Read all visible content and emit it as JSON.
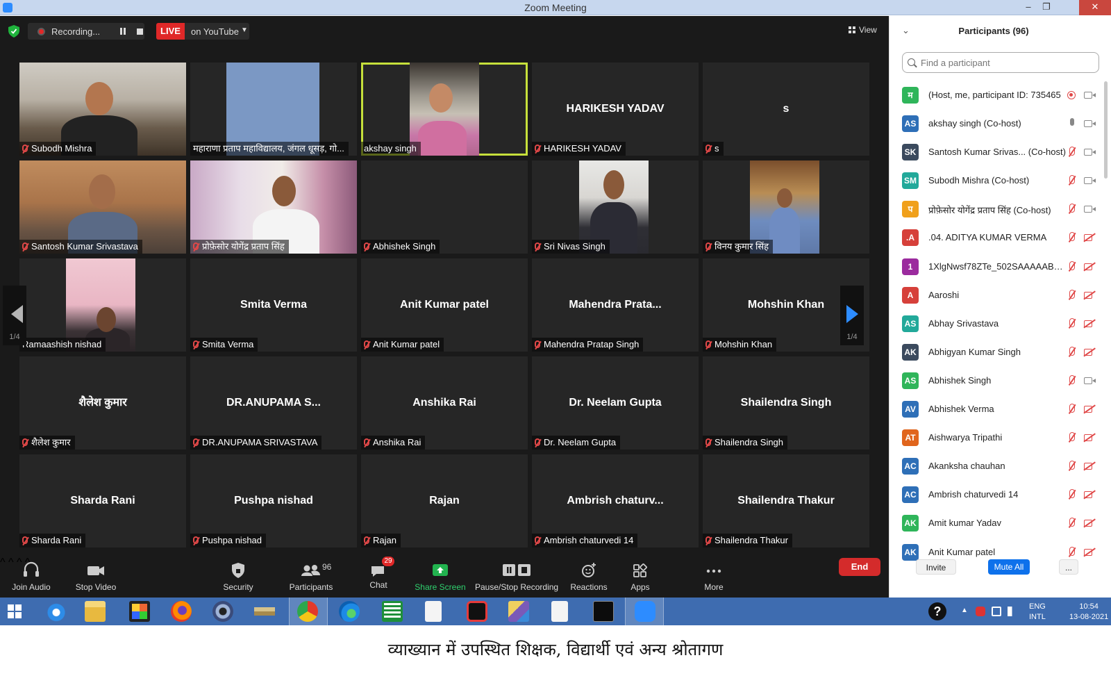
{
  "window": {
    "title": "Zoom Meeting",
    "controls": {
      "minimize": "–",
      "restore": "❐",
      "close": "✕"
    }
  },
  "topbar": {
    "recording_label": "Recording...",
    "live_label": "LIVE",
    "live_target": "on YouTube",
    "view_label": "View"
  },
  "gallery": {
    "page_indicator_left": "1/4",
    "page_indicator_right": "1/4",
    "tiles": [
      {
        "display": "",
        "name": "Subodh Mishra",
        "muted": true,
        "video": "room"
      },
      {
        "display": "",
        "name": "महाराणा प्रताप महाविद्यालय, जंगल धूसड़, गो...",
        "muted": false,
        "video": "blue"
      },
      {
        "display": "",
        "name": "akshay singh",
        "muted": false,
        "video": "lecturer",
        "active": true
      },
      {
        "display": "HARIKESH YADAV",
        "name": "HARIKESH YADAV",
        "muted": true
      },
      {
        "display": "s",
        "name": "s",
        "muted": true
      },
      {
        "display": "",
        "name": "Santosh Kumar Srivastava",
        "muted": true,
        "video": "orange"
      },
      {
        "display": "",
        "name": "प्रोफ़ेसोर योगेंद्र प्रताप सिंह",
        "muted": true,
        "video": "curtain"
      },
      {
        "display": "",
        "name": "Abhishek Singh",
        "muted": true
      },
      {
        "display": "",
        "name": "Sri Nivas Singh",
        "muted": true,
        "video": "officer"
      },
      {
        "display": "",
        "name": "विनय कुमार सिंह",
        "muted": true,
        "video": "shelf"
      },
      {
        "display": "",
        "name": "Ramaashish nishad",
        "muted": false,
        "video": "pink"
      },
      {
        "display": "Smita Verma",
        "name": "Smita Verma",
        "muted": true
      },
      {
        "display": "Anit Kumar patel",
        "name": "Anit Kumar patel",
        "muted": true
      },
      {
        "display": "Mahendra Prata...",
        "name": "Mahendra Pratap Singh",
        "muted": true
      },
      {
        "display": "Mohshin Khan",
        "name": "Mohshin Khan",
        "muted": true
      },
      {
        "display": "शैलेश कुमार",
        "name": "शैलेश कुमार",
        "muted": true
      },
      {
        "display": "DR.ANUPAMA S...",
        "name": "DR.ANUPAMA SRIVASTAVA",
        "muted": true
      },
      {
        "display": "Anshika Rai",
        "name": "Anshika Rai",
        "muted": true
      },
      {
        "display": "Dr. Neelam Gupta",
        "name": "Dr. Neelam Gupta",
        "muted": true
      },
      {
        "display": "Shailendra Singh",
        "name": "Shailendra Singh",
        "muted": true
      },
      {
        "display": "Sharda Rani",
        "name": "Sharda Rani",
        "muted": true
      },
      {
        "display": "Pushpa nishad",
        "name": "Pushpa nishad",
        "muted": true
      },
      {
        "display": "Rajan",
        "name": "Rajan",
        "muted": true
      },
      {
        "display": "Ambrish chaturv...",
        "name": "Ambrish chaturvedi 14",
        "muted": true
      },
      {
        "display": "Shailendra Thakur",
        "name": "Shailendra Thakur",
        "muted": true
      }
    ]
  },
  "toolbar": {
    "join_audio": "Join Audio",
    "stop_video": "Stop Video",
    "security": "Security",
    "participants": "Participants",
    "participants_count": "96",
    "chat": "Chat",
    "chat_badge": "29",
    "share_screen": "Share Screen",
    "pause_stop_recording": "Pause/Stop Recording",
    "reactions": "Reactions",
    "apps": "Apps",
    "more": "More",
    "end": "End"
  },
  "participants_panel": {
    "title": "Participants (96)",
    "search_placeholder": "Find a participant",
    "invite": "Invite",
    "mute_all": "Mute All",
    "more": "...",
    "items": [
      {
        "initials": "म",
        "color": "#2fb55a",
        "name": "(Host, me, participant ID: 735465",
        "mic": "rec",
        "cam": "on"
      },
      {
        "initials": "AS",
        "color": "#2e6fb7",
        "name": "akshay singh (Co-host)",
        "mic": "on",
        "cam": "on"
      },
      {
        "initials": "SK",
        "color": "#3b4a5e",
        "name": "Santosh Kumar Srivas... (Co-host)",
        "mic": "off",
        "cam": "on"
      },
      {
        "initials": "SM",
        "color": "#22a99a",
        "name": "Subodh Mishra (Co-host)",
        "mic": "off",
        "cam": "on"
      },
      {
        "initials": "प",
        "color": "#f0a01b",
        "name": "प्रोफ़ेसोर योगेंद्र प्रताप सिंह (Co-host)",
        "mic": "off",
        "cam": "on"
      },
      {
        "initials": ".A",
        "color": "#d6403a",
        "name": ".04. ADITYA KUMAR VERMA",
        "mic": "off",
        "cam": "off"
      },
      {
        "initials": "1",
        "color": "#9b2b9e",
        "name": "1XlgNwsf78ZTe_502SAAAAABZE...",
        "mic": "off",
        "cam": "off"
      },
      {
        "initials": "A",
        "color": "#d6403a",
        "name": "Aaroshi",
        "mic": "off",
        "cam": "off"
      },
      {
        "initials": "AS",
        "color": "#22a99a",
        "name": "Abhay Srivastava",
        "mic": "off",
        "cam": "off"
      },
      {
        "initials": "AK",
        "color": "#3b4a5e",
        "name": "Abhigyan Kumar Singh",
        "mic": "off",
        "cam": "off"
      },
      {
        "initials": "AS",
        "color": "#2fb55a",
        "name": "Abhishek Singh",
        "mic": "off",
        "cam": "on"
      },
      {
        "initials": "AV",
        "color": "#2e6fb7",
        "name": "Abhishek Verma",
        "mic": "off",
        "cam": "off"
      },
      {
        "initials": "AT",
        "color": "#e0651d",
        "name": "Aishwarya Tripathi",
        "mic": "off",
        "cam": "off"
      },
      {
        "initials": "AC",
        "color": "#2e6fb7",
        "name": "Akanksha chauhan",
        "mic": "off",
        "cam": "off"
      },
      {
        "initials": "AC",
        "color": "#2e6fb7",
        "name": "Ambrish chaturvedi 14",
        "mic": "off",
        "cam": "off"
      },
      {
        "initials": "AK",
        "color": "#2fb55a",
        "name": "Amit kumar Yadav",
        "mic": "off",
        "cam": "off"
      },
      {
        "initials": "AK",
        "color": "#2e6fb7",
        "name": "Anit Kumar patel",
        "mic": "off",
        "cam": "off"
      }
    ]
  },
  "taskbar": {
    "help": "?",
    "lang_line1": "ENG",
    "lang_line2": "INTL",
    "time": "10:54",
    "date": "13-08-2021",
    "apps": [
      "start-button",
      "internet-explorer-icon",
      "file-explorer-icon",
      "paint-app-icon",
      "firefox-icon",
      "media-app-icon",
      "books-app-icon",
      "chrome-icon",
      "edge-icon",
      "calculator-icon",
      "document-icon",
      "screen-recorder-icon",
      "image-viewer-icon",
      "blank-document-icon",
      "command-prompt-icon",
      "zoom-icon"
    ]
  },
  "caption": "व्याख्यान में उपस्थित शिक्षक, विद्यार्थी एवं अन्य श्रोतागण"
}
